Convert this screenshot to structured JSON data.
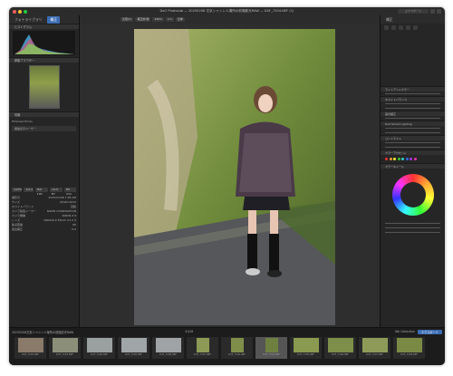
{
  "window": {
    "title": "DxO PhotoLab — 20250208 文京シャシン人場所の前撮影光RAW — DXF_7304.NEF (1)",
    "export_label": "エクスポート"
  },
  "left": {
    "tabs": [
      "フォトライブラリ",
      "補正"
    ],
    "histogram_title": "ヒストグラム",
    "navigator_title": "移動ブラウザー",
    "info_title": "情報",
    "camera_section": "Hillaread Photo",
    "camera_detail": "開放表示ユーザー",
    "exif": [
      {
        "k": "1/250",
        "v": "1/2.2"
      },
      {
        "k": "ISO 100",
        "v": "f/1.4"
      },
      {
        "k": "85 mm",
        "v": "+0.0 EV"
      }
    ],
    "meta": [
      {
        "k": "撮影日",
        "v": "2025/01/08 7:48 AM"
      },
      {
        "k": "サイズ",
        "v": "6048×4032"
      },
      {
        "k": "ホワイトバランス",
        "v": "自動"
      },
      {
        "k": "カメラ製造メーカー",
        "v": "NIKON CORPORATION"
      },
      {
        "k": "カメラ機種",
        "v": "NIKON Z 8"
      },
      {
        "k": "レンズ",
        "v": "NIKKOR Z 85mm f/1.2 S"
      },
      {
        "k": "焦点距離",
        "v": "85"
      },
      {
        "k": "露出補正",
        "v": "0.0"
      }
    ]
  },
  "center": {
    "toolbar": [
      "比較(C)",
      "補正前/後",
      "100%",
      "1:1",
      "全体"
    ]
  },
  "right": {
    "title": "補正",
    "sections": [
      "ライトアンドカラー",
      "ホワイトバランス",
      "露光補正",
      "DxO Smart Lighting",
      "コントラスト",
      "カラーホイール",
      "カラーアクセント"
    ],
    "wheel_label": "Color Wheel"
  },
  "filmstrip": {
    "path": "20250208文京シャシン人場所の前撮影光RAW",
    "count": "41/26",
    "collection": "Nik Collection",
    "items": [
      {
        "name": "DXF_7292.NEF"
      },
      {
        "name": "DXF_7293.NEF"
      },
      {
        "name": "DXF_7294.NEF"
      },
      {
        "name": "DXF_7295.NEF"
      },
      {
        "name": "DXF_7296.NEF"
      },
      {
        "name": "DXF_7301.NEF"
      },
      {
        "name": "DXF_7302.NEF"
      },
      {
        "name": "DXF_7303.NEF"
      },
      {
        "name": "DXF_7304.NEF"
      },
      {
        "name": "DXF_7305.NEF"
      },
      {
        "name": "DXF_7306.NEF"
      },
      {
        "name": "DXF_7307.NEF"
      },
      {
        "name": "DXF_7308.NEF"
      }
    ]
  },
  "colors": {
    "accent": "#3d6db5",
    "panel": "#262626"
  }
}
